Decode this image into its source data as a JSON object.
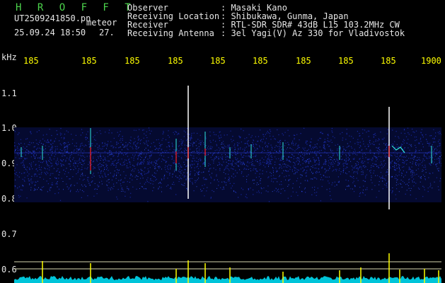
{
  "header": {
    "app_title": "H R O F F T",
    "file_name": "UT2509241850.pn",
    "type_label": "meteor",
    "datetime": "25.09.24 18:50",
    "count": "27.",
    "fields": [
      {
        "label": "Observer",
        "value": ": Masaki Kano"
      },
      {
        "label": "Receiving Location",
        "value": ": Shibukawa, Gunma, Japan"
      },
      {
        "label": "Receiver",
        "value": ": RTL-SDR SDR# 43dB L15 103.2MHz CW"
      },
      {
        "label": "Receiving Antenna",
        "value": ": 3el Yagi(V) Az 330 for Vladivostok"
      }
    ]
  },
  "axis": {
    "y_unit": "kHz",
    "y_labels": [
      "1.1",
      "1.0",
      "0.9",
      "0.8",
      "0.7",
      "0.6"
    ],
    "x_labels": [
      "185",
      "185",
      "185",
      "185",
      "185",
      "185",
      "185",
      "185",
      "185",
      "1900"
    ]
  },
  "colors": {
    "background": "#000000",
    "band": "#1a2aa8",
    "echo_bright": "#ffffff",
    "echo_mid": "#30e8e0",
    "echo_hot": "#ff2020",
    "level_trace": "#00e6ff",
    "peak_marker": "#ffff00",
    "threshold_line": "#d8d8b0",
    "x_tick_text": "#ffff00",
    "header_text": "#e6e6e6",
    "title_text": "#4cd44c"
  }
}
